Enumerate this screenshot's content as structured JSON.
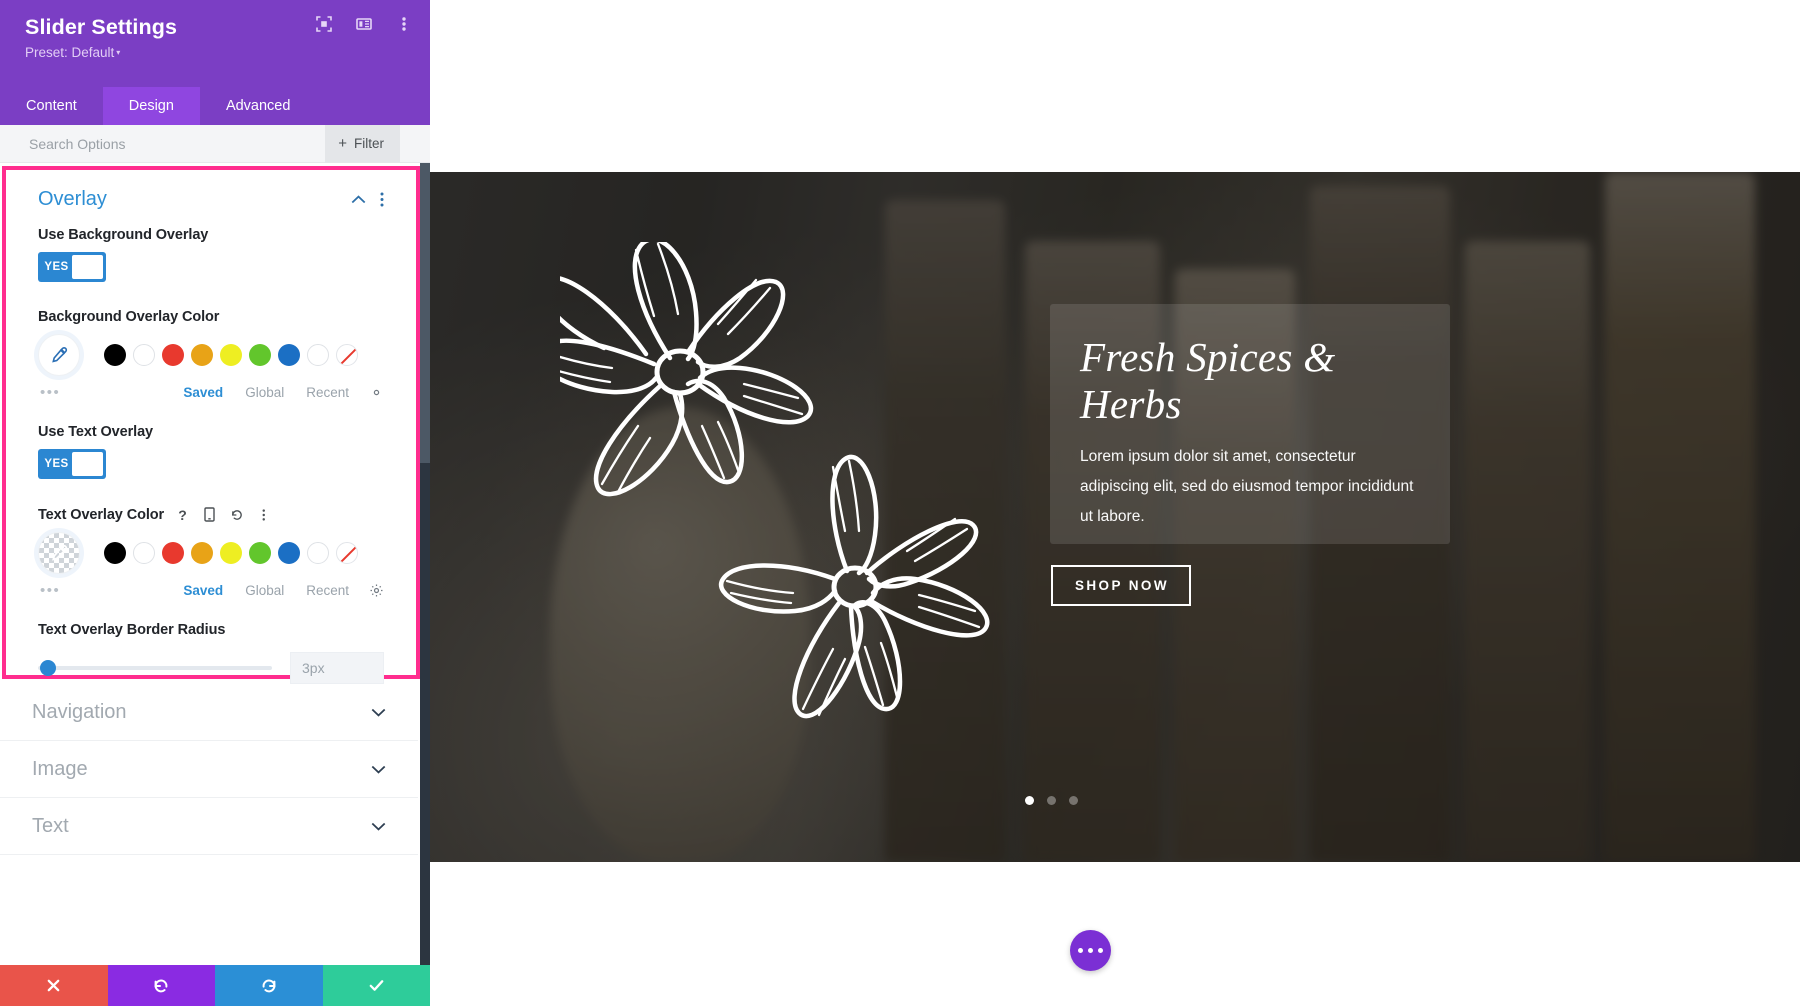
{
  "panel": {
    "title": "Slider Settings",
    "preset": "Preset: Default",
    "preset_caret": "▾",
    "header_icons": [
      {
        "name": "focus-frame-icon",
        "label": "Focus"
      },
      {
        "name": "layout-columns-icon",
        "label": "Layout"
      },
      {
        "name": "kebab-menu-icon",
        "label": "More"
      }
    ],
    "tabs": [
      {
        "label": "Content",
        "active": false
      },
      {
        "label": "Design",
        "active": true
      },
      {
        "label": "Advanced",
        "active": false
      }
    ],
    "search": {
      "placeholder": "Search Options",
      "value": "",
      "filter_label": "Filter",
      "filter_plus": "+"
    },
    "group": {
      "title": "Overlay",
      "collapse_icon": "chevron-up",
      "menu_icon": "kebab"
    },
    "use_background_overlay": {
      "label": "Use Background Overlay",
      "state": "YES"
    },
    "background_overlay_color": {
      "label": "Background Overlay Color",
      "picker_icon": "eyedropper",
      "swatches": [
        {
          "name": "black",
          "hex": "#000000"
        },
        {
          "name": "white",
          "hex": "#ffffff"
        },
        {
          "name": "red",
          "hex": "#e8392e"
        },
        {
          "name": "orange",
          "hex": "#e8a317"
        },
        {
          "name": "yellow",
          "hex": "#eeee22"
        },
        {
          "name": "green",
          "hex": "#62c62c"
        },
        {
          "name": "blue",
          "hex": "#1b6fc4"
        },
        {
          "name": "empty",
          "hex": "#ffffff"
        },
        {
          "name": "none",
          "hex": "transparent"
        }
      ],
      "more_dots": "•••",
      "tabs": [
        {
          "label": "Saved",
          "active": true
        },
        {
          "label": "Global",
          "active": false
        },
        {
          "label": "Recent",
          "active": false
        }
      ],
      "settings_icon": "gear"
    },
    "use_text_overlay": {
      "label": "Use Text Overlay",
      "state": "YES"
    },
    "text_overlay_color": {
      "label": "Text Overlay Color",
      "icons": [
        {
          "name": "help-icon",
          "glyph": "?"
        },
        {
          "name": "responsive-device-icon",
          "glyph": "device"
        },
        {
          "name": "reset-icon",
          "glyph": "↺"
        },
        {
          "name": "kebab-menu-icon",
          "glyph": "⋮"
        }
      ],
      "picker_swatch": "transparent-checker",
      "swatches": [
        {
          "name": "black",
          "hex": "#000000"
        },
        {
          "name": "white",
          "hex": "#ffffff"
        },
        {
          "name": "red",
          "hex": "#e8392e"
        },
        {
          "name": "orange",
          "hex": "#e8a317"
        },
        {
          "name": "yellow",
          "hex": "#eeee22"
        },
        {
          "name": "green",
          "hex": "#62c62c"
        },
        {
          "name": "blue",
          "hex": "#1b6fc4"
        },
        {
          "name": "empty",
          "hex": "#ffffff"
        },
        {
          "name": "none",
          "hex": "transparent"
        }
      ],
      "more_dots": "•••",
      "tabs": [
        {
          "label": "Saved",
          "active": true
        },
        {
          "label": "Global",
          "active": false
        },
        {
          "label": "Recent",
          "active": false
        }
      ],
      "settings_icon": "gear"
    },
    "text_overlay_border_radius": {
      "label": "Text Overlay Border Radius",
      "value": "3px",
      "slider_percent": 1
    },
    "collapsed_sections": [
      {
        "label": "Navigation"
      },
      {
        "label": "Image"
      },
      {
        "label": "Text"
      }
    ],
    "footer": [
      {
        "name": "cancel",
        "icon": "✕",
        "color": "#e9544a"
      },
      {
        "name": "undo",
        "icon": "↺",
        "color": "#8a2be2"
      },
      {
        "name": "redo",
        "icon": "↻",
        "color": "#2b8fd6"
      },
      {
        "name": "save",
        "icon": "✔",
        "color": "#2ecc9a"
      }
    ],
    "highlight_color": "#ff2d8e"
  },
  "preview": {
    "slide": {
      "title": "Fresh Spices & Herbs",
      "description": "Lorem ipsum dolor sit amet, consectetur adipiscing elit, sed do eiusmod tempor incididunt ut labore.",
      "button_label": "SHOP NOW",
      "dots_total": 3,
      "dots_active_index": 0
    },
    "fab": {
      "name": "more-options-button",
      "icon": "•••"
    }
  }
}
